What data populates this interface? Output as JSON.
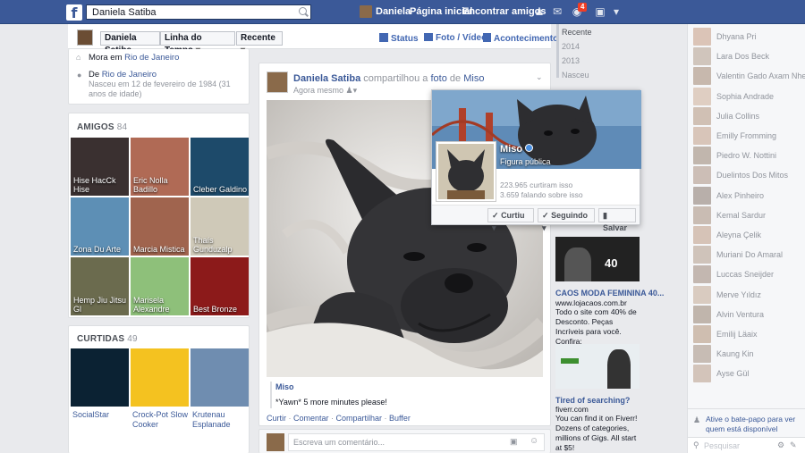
{
  "topbar": {
    "search_value": "Daniela Satiba",
    "user_name": "Daniela",
    "home": "Página inicial",
    "find_friends": "Encontrar amigos",
    "notif_count": "4"
  },
  "subnav": {
    "name": "Daniela Satiba",
    "timeline": "Linha do Tempo",
    "recent": "Recente",
    "status": "Status",
    "photo_video": "Foto / Vídeo",
    "event": "Acontecimento"
  },
  "about": {
    "lives_prefix": "Mora em",
    "lives_city": "Rio de Janeiro",
    "from_prefix": "De",
    "from_city": "Rio de Janeiro",
    "born": "Nasceu em 12 de fevereiro de 1984 (31 anos de idade)"
  },
  "friends": {
    "title": "AMIGOS",
    "count": "84",
    "items": [
      {
        "name": "Hise HacCk Hise",
        "color": "#3a3030"
      },
      {
        "name": "Eric Nolla Badillo",
        "color": "#b06a55"
      },
      {
        "name": "Cleber Galdino",
        "color": "#1d4a6a"
      },
      {
        "name": "Zona Du Arte",
        "color": "#5d8fb5"
      },
      {
        "name": "Marcia Mistica",
        "color": "#a0644e"
      },
      {
        "name": "Thaís Gunduzalp",
        "color": "#cfc9b8"
      },
      {
        "name": "Hemp Jiu Jitsu Gl",
        "color": "#6b6b4e"
      },
      {
        "name": "Marisela Alexandre",
        "color": "#8ec07a"
      },
      {
        "name": "Best Bronze",
        "color": "#8c1a1a"
      }
    ]
  },
  "likes": {
    "title": "CURTIDAS",
    "count": "49",
    "items": [
      {
        "name": "SocialStar",
        "color": "#0b2233"
      },
      {
        "name": "Crock-Pot Slow Cooker",
        "color": "#f4c220"
      },
      {
        "name": "Krutenau Esplanade",
        "color": "#6f8db0"
      }
    ]
  },
  "post": {
    "author": "Daniela Satiba",
    "shared": "compartilhou a",
    "photo_word": "foto",
    "of_word": "de",
    "page": "Miso",
    "time": "Agora mesmo",
    "caption_page": "Miso",
    "caption": "*Yawn* 5 more minutes please!",
    "actions": [
      "Curtir",
      "Comentar",
      "Compartilhar",
      "Buffer"
    ],
    "comment_placeholder": "Escreva um comentário..."
  },
  "timeline_years": [
    "Recente",
    "2014",
    "2013",
    "Nasceu"
  ],
  "popup": {
    "name": "Miso",
    "category": "Figura pública",
    "likes": "223.965 curtiram isso",
    "talking": "3.659 falando sobre isso",
    "liked_btn": "Curtiu",
    "following_btn": "Seguindo",
    "save_btn": "Salvar"
  },
  "ads": [
    {
      "title": "CAOS MODA FEMININA 40...",
      "url": "www.lojacaos.com.br",
      "text": "Todo o site com 40% de Desconto. Peças Incríveis para você. Confira:",
      "badge": "40"
    },
    {
      "title": "Tired of searching?",
      "url": "fiverr.com",
      "text": "You can find it on Fiverr! Dozens of categories, millions of Gigs. All start at $5!"
    }
  ],
  "chat": {
    "contacts": [
      "Dhyana Pri",
      "Lara Dos Beck",
      "Valentin Gado Axam Nhetz",
      "Sophia Andrade",
      "Julia Collins",
      "Emilly Fromming",
      "Piedro W. Nottini",
      "Duelintos Dos Mitos",
      "Alex Pinheiro",
      "Kemal Sardur",
      "Aleyna Çelik",
      "Muriani Do Amaral",
      "Luccas Sneijder",
      "Merve Yıldız",
      "Alvin Ventura",
      "Emilij Läaix",
      "Kaung Kin",
      "Ayse Gül"
    ],
    "enable_text": "Ative o bate-papo para ver quem está disponível",
    "search_placeholder": "Pesquisar"
  }
}
